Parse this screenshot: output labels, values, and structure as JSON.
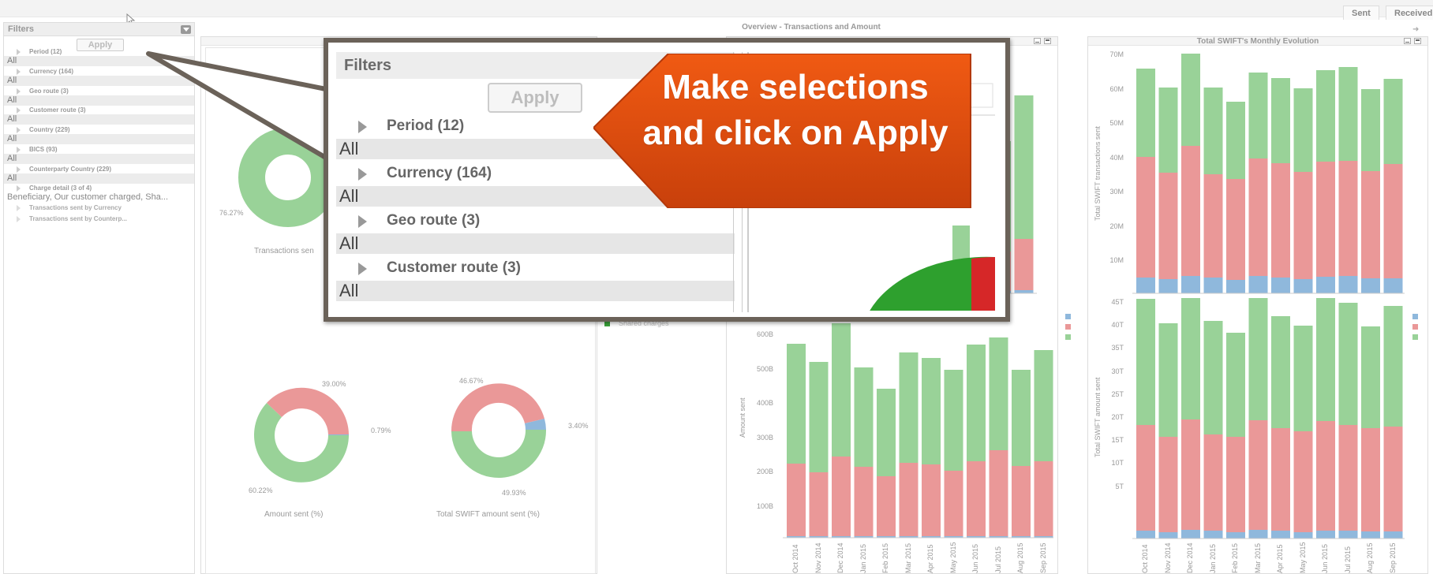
{
  "tabs": {
    "sent": "Sent",
    "received": "Received"
  },
  "sidebar": {
    "title": "Filters",
    "apply": "Apply",
    "items": [
      {
        "label": "Period (12)",
        "value": "All"
      },
      {
        "label": "Currency (164)",
        "value": "All"
      },
      {
        "label": "Geo route (3)",
        "value": "All"
      },
      {
        "label": "Customer route (3)",
        "value": "All"
      },
      {
        "label": "Country (229)",
        "value": "All"
      },
      {
        "label": "BICS (93)",
        "value": "All"
      },
      {
        "label": "Counterparty Country (229)",
        "value": "All"
      },
      {
        "label": "Charge detail (3 of 4)",
        "value": "Beneficiary, Our customer charged, Sha..."
      }
    ],
    "sub_items": [
      "Transactions sent by Currency",
      "Transactions sent by Counterp..."
    ]
  },
  "overview_title": "Overview - Transactions and Amount",
  "donuts": {
    "top": {
      "pct_left": "76.27%",
      "title": "Transactions sen"
    },
    "amount": {
      "title": "Amount sent (%)",
      "pct_top": "39.00%",
      "pct_right": "0.79%",
      "pct_bottom": "60.22%"
    },
    "swift": {
      "title": "Total SWIFT amount sent (%)",
      "pct_top": "46.67%",
      "pct_right": "3.40%",
      "pct_bottom": "49.93%"
    },
    "legend": "Shared charges"
  },
  "months": [
    "Oct 2014",
    "Nov 2014",
    "Dec 2014",
    "Jan 2015",
    "Feb 2015",
    "Mar 2015",
    "Apr 2015",
    "May 2015",
    "Jun 2015",
    "Jul 2015",
    "Aug 2015",
    "Sep 2015"
  ],
  "mid_lower": {
    "ylabel": "Amount sent",
    "yticks": [
      "600B",
      "500B",
      "400B",
      "300B",
      "200B",
      "100B"
    ]
  },
  "right_top": {
    "title": "Total SWIFT's Monthly Evolution",
    "ylabel": "Total SWIFT transactions sent",
    "yticks": [
      "70M",
      "60M",
      "50M",
      "40M",
      "30M",
      "20M",
      "10M"
    ]
  },
  "right_bottom": {
    "ylabel": "Total SWIFT amount sent",
    "yticks": [
      "45T",
      "40T",
      "35T",
      "30T",
      "25T",
      "20T",
      "15T",
      "10T",
      "5T"
    ]
  },
  "colors": {
    "green": "#99d298",
    "red": "#ea9898",
    "blue": "#8fb8dc",
    "callout_orange": "#e85a10"
  },
  "callout": {
    "head": "Filters",
    "apply": "Apply",
    "items": [
      {
        "label": "Period (12)",
        "value": "All"
      },
      {
        "label": "Currency (164)",
        "value": "All"
      },
      {
        "label": "Geo route (3)",
        "value": "All"
      },
      {
        "label": "Customer route (3)",
        "value": "All"
      }
    ],
    "bubble_text": "Make selections and click on Apply"
  }
}
